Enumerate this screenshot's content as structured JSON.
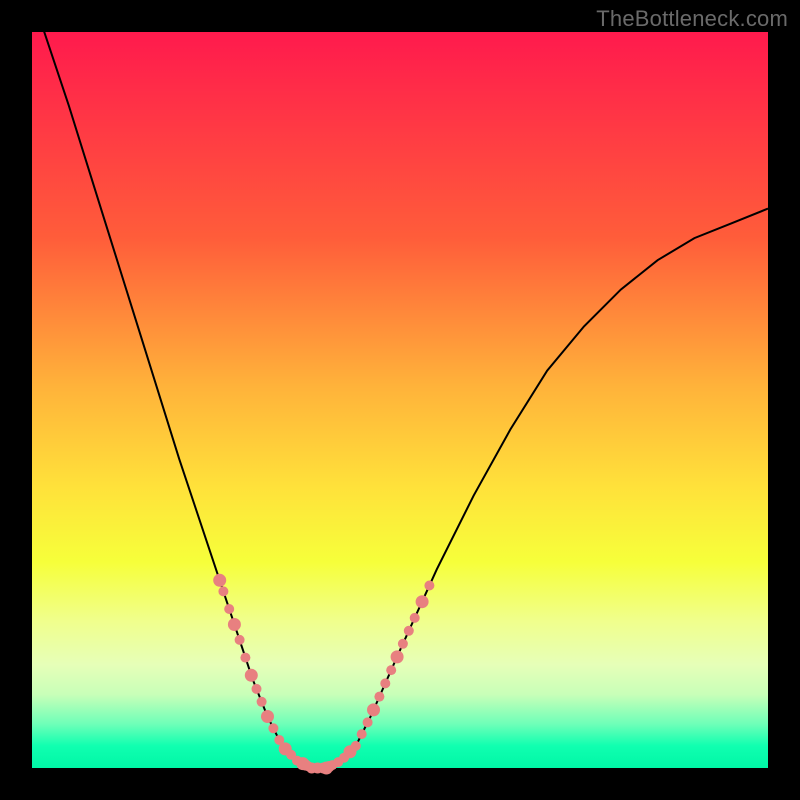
{
  "watermark": "TheBottleneck.com",
  "chart_data": {
    "type": "line",
    "title": "",
    "xlabel": "",
    "ylabel": "",
    "xlim": [
      0,
      1
    ],
    "ylim": [
      0,
      1
    ],
    "series": [
      {
        "name": "bottleneck-curve",
        "x": [
          0.0,
          0.05,
          0.1,
          0.15,
          0.2,
          0.25,
          0.28,
          0.3,
          0.32,
          0.34,
          0.36,
          0.38,
          0.4,
          0.42,
          0.44,
          0.46,
          0.5,
          0.55,
          0.6,
          0.65,
          0.7,
          0.75,
          0.8,
          0.85,
          0.9,
          0.95,
          1.0
        ],
        "y": [
          1.05,
          0.9,
          0.74,
          0.58,
          0.42,
          0.27,
          0.18,
          0.12,
          0.07,
          0.03,
          0.01,
          0.0,
          0.0,
          0.01,
          0.03,
          0.07,
          0.16,
          0.27,
          0.37,
          0.46,
          0.54,
          0.6,
          0.65,
          0.69,
          0.72,
          0.74,
          0.76
        ]
      }
    ],
    "highlight_dots": {
      "name": "highlighted-points",
      "color": "#e88080",
      "left_cluster_x": [
        0.255,
        0.26,
        0.268,
        0.275,
        0.282,
        0.29,
        0.298,
        0.305,
        0.312,
        0.32,
        0.328,
        0.336,
        0.344,
        0.352,
        0.36,
        0.368,
        0.376
      ],
      "right_cluster_x": [
        0.4,
        0.408,
        0.416,
        0.424,
        0.432,
        0.44,
        0.448,
        0.456,
        0.464,
        0.472,
        0.48,
        0.488,
        0.496,
        0.504,
        0.512,
        0.52,
        0.53,
        0.54
      ],
      "bottom_cluster_x": [
        0.372,
        0.38,
        0.388,
        0.396,
        0.404
      ]
    }
  }
}
